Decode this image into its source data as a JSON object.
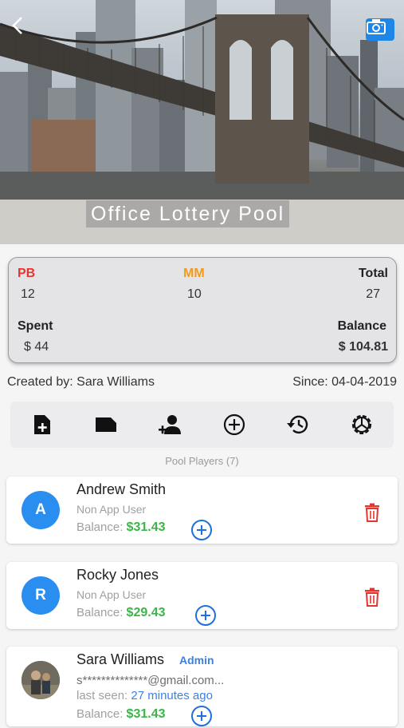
{
  "header": {
    "title": "Office Lottery Pool",
    "back_icon": "chevron-left-icon",
    "camera_icon": "camera-icon"
  },
  "summary": {
    "pb_label": "PB",
    "pb_value": "12",
    "mm_label": "MM",
    "mm_value": "10",
    "total_label": "Total",
    "total_value": "27",
    "spent_label": "Spent",
    "spent_value": "$ 44",
    "balance_label": "Balance",
    "balance_value": "$ 104.81",
    "colors": {
      "pb": "#e8342f",
      "mm": "#f29b1b",
      "balance": "#3db449"
    }
  },
  "meta": {
    "created_by": "Created by: Sara Williams",
    "since": "Since: 04-04-2019"
  },
  "toolbar": {
    "icons": [
      "add-ticket-icon",
      "ticket-folder-icon",
      "add-player-icon",
      "add-circle-icon",
      "history-icon",
      "settings-icon"
    ]
  },
  "players_label": "Pool Players (7)",
  "players": [
    {
      "initial": "A",
      "name": "Andrew Smith",
      "type": "Non App User",
      "balance_label": "Balance:",
      "balance": "$31.43"
    },
    {
      "initial": "R",
      "name": "Rocky Jones",
      "type": "Non App User",
      "balance_label": "Balance:",
      "balance": "$29.43"
    },
    {
      "name": "Sara Williams",
      "badge": "Admin",
      "email": "s**************@gmail.com...",
      "last_seen_label": "last seen:",
      "last_seen": "27 minutes ago",
      "balance_label": "Balance:",
      "balance": "$31.43"
    }
  ]
}
